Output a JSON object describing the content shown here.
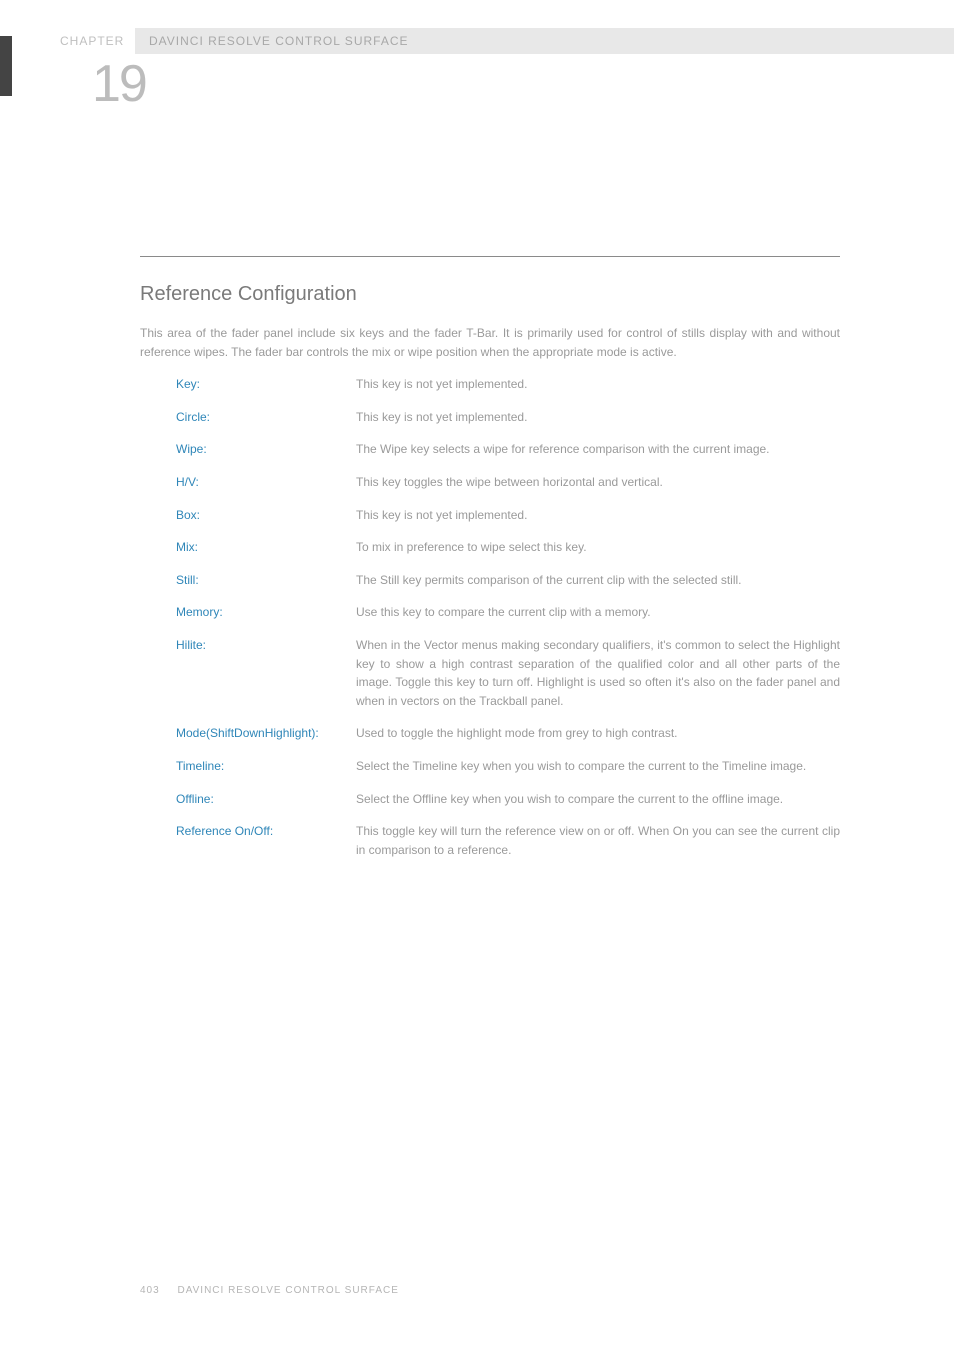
{
  "chapter_label": "CHAPTER",
  "section_bar": "DAVINCI RESOLVE CONTROL SURFACE",
  "chapter_number": "19",
  "heading": "Reference Configuration",
  "intro": "This area of the fader panel include six keys and the fader T-Bar. It is primarily used for control of stills display with and without reference wipes. The fader bar controls the mix or wipe position when the appropriate mode is active.",
  "defs": [
    {
      "term": "Key:",
      "desc": "This key is not yet implemented."
    },
    {
      "term": "Circle:",
      "desc": "This key is not yet implemented."
    },
    {
      "term": "Wipe:",
      "desc": "The Wipe key selects a wipe for reference comparison with the current image."
    },
    {
      "term": "H/V:",
      "desc": "This key toggles the wipe between horizontal and vertical."
    },
    {
      "term": "Box:",
      "desc": "This key is not yet implemented."
    },
    {
      "term": "Mix:",
      "desc": "To mix in preference to wipe select this key."
    },
    {
      "term": "Still:",
      "desc": "The Still key permits comparison of the current clip with the selected still."
    },
    {
      "term": "Memory:",
      "desc": "Use this key to compare the current clip with a memory."
    },
    {
      "term": "Hilite:",
      "desc": "When in the Vector menus making secondary qualifiers, it's common to select the Highlight key to show a high contrast separation of the qualified color and all other parts of the image. Toggle this key to turn off. Highlight is used so often it's also on the fader panel and when in vectors on the Trackball panel."
    },
    {
      "term": "Mode(ShiftDownHighlight):",
      "desc": "Used to toggle the highlight mode from grey to high contrast."
    },
    {
      "term": "Timeline:",
      "desc": "Select the Timeline key when you wish to compare the current to the Timeline image."
    },
    {
      "term": "Offline:",
      "desc": "Select the Offline key when you wish to compare the current to the offline image."
    },
    {
      "term": "Reference On/Off:",
      "desc": "This toggle key will turn the reference view on or off. When On you can see the current clip in comparison to a reference."
    }
  ],
  "footer_page": "403",
  "footer_text": "DAVINCI RESOLVE CONTROL SURFACE"
}
